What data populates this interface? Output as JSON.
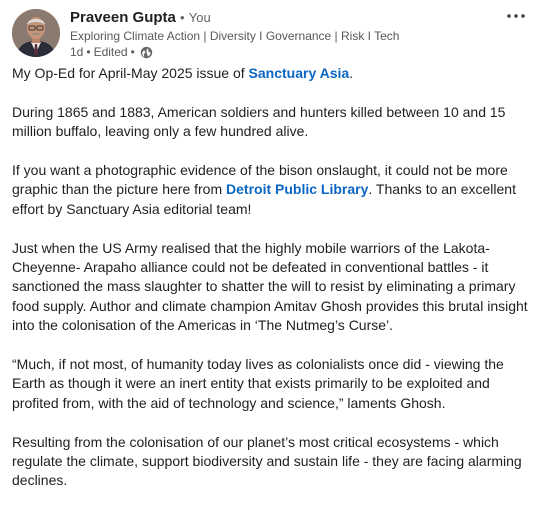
{
  "author": {
    "name": "Praveen Gupta",
    "separator": "•",
    "you_label": "You",
    "headline": "Exploring Climate Action | Diversity I Governance | Risk I Tech",
    "time": "1d",
    "edited": "Edited",
    "visibility_icon": "globe-icon"
  },
  "menu": {
    "more_icon": "ellipsis-icon"
  },
  "post": {
    "p1_before": "My Op-Ed for April-May 2025 issue of ",
    "p1_link": "Sanctuary Asia",
    "p1_after": ".",
    "p2": "During 1865 and 1883, American soldiers and hunters killed between 10 and 15 million buffalo, leaving only a few hundred alive.",
    "p3_before": "If you want a photographic evidence of the bison onslaught, it could not be more graphic than the picture here from ",
    "p3_link": "Detroit Public Library",
    "p3_after": ". Thanks to an excellent effort by Sanctuary Asia editorial team!",
    "p4": "Just when the US Army realised that the highly mobile warriors of the Lakota-Cheyenne- Arapaho alliance could not be defeated in conventional battles - it sanctioned the mass slaughter to shatter the will to resist by eliminating a primary food supply. Author and climate champion Amitav Ghosh provides this brutal insight into the colonisation of the Americas in ‘The Nutmeg’s Curse’.",
    "p5": "“Much, if not most, of humanity today lives as colonialists once did - viewing the Earth as though it were an inert entity that exists primarily to be exploited and profited from, with the aid of technology and science,” laments Ghosh.",
    "p6": "Resulting from the colonisation of our planet’s most critical ecosystems - which regulate the climate, support biodiversity and sustain life - they are facing alarming declines."
  },
  "colors": {
    "link": "#0a66c2",
    "text": "#1f1f1f",
    "muted": "#595959"
  }
}
